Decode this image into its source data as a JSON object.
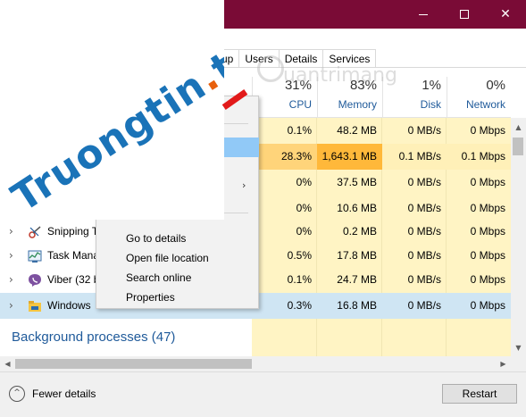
{
  "window": {
    "accent_color": "#7a0b36",
    "controls": {
      "minimize": "minimize-icon",
      "maximize": "maximize-icon",
      "close": "close-icon"
    },
    "close_glyph": "✕"
  },
  "tabs": [
    {
      "label": "up"
    },
    {
      "label": "Users"
    },
    {
      "label": "Details"
    },
    {
      "label": "Services"
    }
  ],
  "columns": {
    "cpu": {
      "percent": "31%",
      "label": "CPU"
    },
    "memory": {
      "percent": "83%",
      "label": "Memory"
    },
    "disk": {
      "percent": "1%",
      "label": "Disk"
    },
    "network": {
      "percent": "0%",
      "label": "Network"
    }
  },
  "rows": [
    {
      "name": "",
      "cpu": "0.1%",
      "memory": "48.2 MB",
      "disk": "0 MB/s",
      "network": "0 Mbps"
    },
    {
      "name": "",
      "cpu": "28.3%",
      "memory": "1,643.1 MB",
      "disk": "0.1 MB/s",
      "network": "0.1 Mbps"
    },
    {
      "name": "",
      "cpu": "0%",
      "memory": "37.5 MB",
      "disk": "0 MB/s",
      "network": "0 Mbps"
    },
    {
      "name": "",
      "cpu": "0%",
      "memory": "10.6 MB",
      "disk": "0 MB/s",
      "network": "0 Mbps"
    },
    {
      "name": "Snipping T",
      "cpu": "0%",
      "memory": "0.2 MB",
      "disk": "0 MB/s",
      "network": "0 Mbps"
    },
    {
      "name": "Task Mana",
      "cpu": "0.5%",
      "memory": "17.8 MB",
      "disk": "0 MB/s",
      "network": "0 Mbps"
    },
    {
      "name": "Viber (32 b",
      "cpu": "0.1%",
      "memory": "24.7 MB",
      "disk": "0 MB/s",
      "network": "0 Mbps"
    },
    {
      "name": "Windows",
      "cpu": "0.3%",
      "memory": "16.8 MB",
      "disk": "0 MB/s",
      "network": "0 Mbps"
    }
  ],
  "row_expander_glyph": "›",
  "section": {
    "background_processes": "Background processes (47)"
  },
  "context_menu": {
    "items": [
      {
        "label": "Go to details"
      },
      {
        "label": "Open file location"
      },
      {
        "label": "Search online"
      },
      {
        "label": "Properties"
      }
    ],
    "submenu_glyph": "›"
  },
  "footer": {
    "fewer_details_label": "Fewer details",
    "fewer_details_glyph": "^",
    "restart_label": "Restart"
  },
  "scrollbar_glyphs": {
    "up": "▲",
    "down": "▼",
    "left": "◀",
    "right": "▶"
  },
  "watermark": {
    "main": "Truongtin",
    "dot": ".",
    "tld": "top",
    "faint": "uantrimang"
  }
}
